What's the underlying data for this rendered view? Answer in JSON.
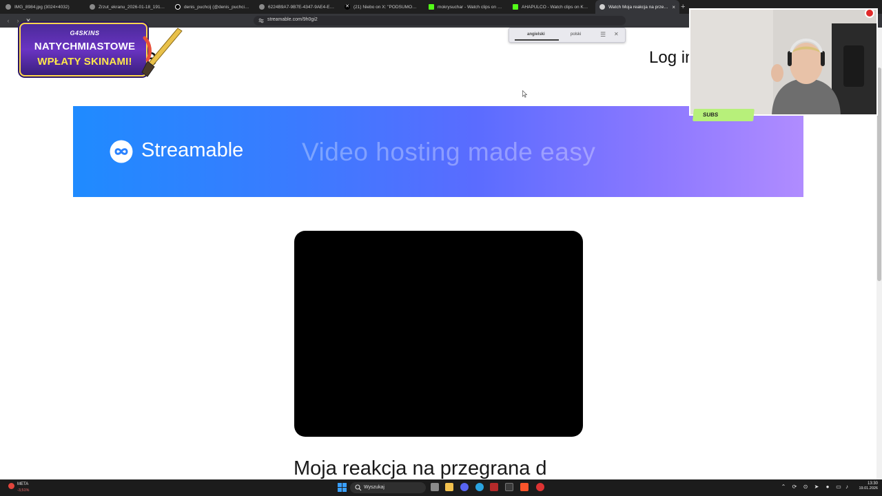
{
  "browser": {
    "tabs": [
      {
        "title": "IMG_8984.jpg (3024×4032)",
        "icon": "image-icon",
        "color": "#9a9a9a"
      },
      {
        "title": "Zrzut_ekranu_2026-01-18_191948.p",
        "icon": "globe-icon",
        "color": "#9a9a9a"
      },
      {
        "title": "denis_puchcij (@denis_puchcij) | TikT",
        "icon": "tiktok-icon",
        "color": "#ffffff"
      },
      {
        "title": "6224B9A7-9B7E-4347-9AE4-E61FEC",
        "icon": "globe-icon",
        "color": "#9a9a9a"
      },
      {
        "title": "(21) Niebo on X: \"PODSUMOWANIE",
        "icon": "x-icon",
        "color": "#ffffff"
      },
      {
        "title": "mokrysuchar - Watch clips on Kick",
        "icon": "kick-icon",
        "color": "#53fc18"
      },
      {
        "title": "AHAPULCO - Watch clips on Kick",
        "icon": "kick-icon",
        "color": "#53fc18"
      },
      {
        "title": "Watch Moja reakcja na przegrana",
        "icon": "streamable-icon",
        "color": "#cfcfcf",
        "active": true
      }
    ],
    "new_tab_label": "+",
    "url": "streamable.com/9h0gi2",
    "translate": {
      "source_lang": "angielski",
      "target_lang": "polski"
    }
  },
  "page": {
    "logo_text": "able",
    "login_text": "Log in",
    "banner": {
      "brand": "Streamable",
      "tagline": "Video hosting made easy"
    },
    "video_title": "Moja reakcja na przegrana d"
  },
  "overlay": {
    "sponsor": {
      "brand": "G4SKINS",
      "line1": "NATYCHMIASTOWE",
      "line2": "WPŁATY SKINAMI!"
    },
    "subs_label": "SUBS"
  },
  "taskbar": {
    "stock_name": "META",
    "stock_change": "-3,51%",
    "search_placeholder": "Wyszukaj",
    "time": "13:30",
    "date": "19.01.2026"
  },
  "colors": {
    "banner_start": "#1f8bff",
    "banner_end": "#b08cff",
    "subs_badge": "#b7f07a",
    "kick_green": "#53fc18"
  }
}
